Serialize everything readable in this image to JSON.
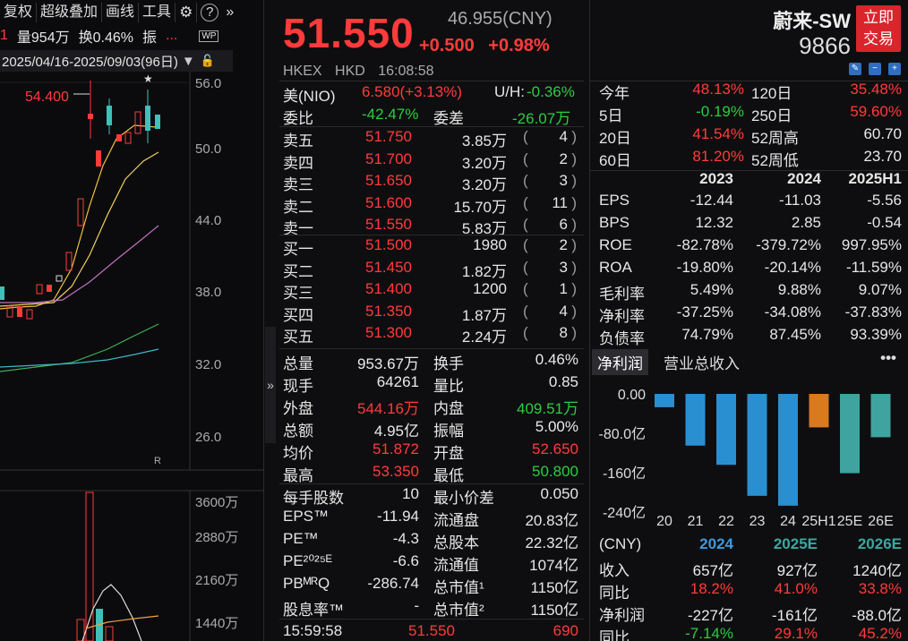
{
  "toolbar": {
    "items": [
      "复权",
      "超级叠加",
      "画线",
      "工具"
    ],
    "gear_icon": "gear-icon",
    "help_icon": "help-icon",
    "expand_icon": "double-chevron-right-icon"
  },
  "toolbar2": {
    "prefix": "1",
    "volume": "量954万",
    "turnover": "换0.46%",
    "amp": "振",
    "more": "...",
    "wp_badge": "WP"
  },
  "date_range": "2025/04/16-2025/09/03(96日)",
  "kline": {
    "price_ticks": [
      "56.0",
      "50.0",
      "44.0",
      "38.0",
      "32.0",
      "26.0"
    ],
    "high_marker": "54.400",
    "star": "★",
    "r_mark": "R",
    "volume_ticks": [
      "3600万",
      "2880万",
      "2160万",
      "1440万"
    ]
  },
  "quote": {
    "price": "51.550",
    "cny_price": "46.955(CNY)",
    "change": "+0.500",
    "change_pct": "+0.98%",
    "exchange": "HKEX",
    "currency": "HKD",
    "time": "16:08:58"
  },
  "adr": {
    "label": "美(NIO)",
    "value": "6.580(+3.13%)",
    "uh_label": "U/H:",
    "uh_value": "-0.36%"
  },
  "committee": {
    "ratio_label": "委比",
    "ratio": "-42.47%",
    "diff_label": "委差",
    "diff": "-26.07万"
  },
  "asks": [
    {
      "label": "卖五",
      "price": "51.750",
      "vol": "3.85万",
      "count": "4"
    },
    {
      "label": "卖四",
      "price": "51.700",
      "vol": "3.20万",
      "count": "2"
    },
    {
      "label": "卖三",
      "price": "51.650",
      "vol": "3.20万",
      "count": "3"
    },
    {
      "label": "卖二",
      "price": "51.600",
      "vol": "15.70万",
      "count": "11"
    },
    {
      "label": "卖一",
      "price": "51.550",
      "vol": "5.83万",
      "count": "6"
    }
  ],
  "bids": [
    {
      "label": "买一",
      "price": "51.500",
      "vol": "1980",
      "count": "2"
    },
    {
      "label": "买二",
      "price": "51.450",
      "vol": "1.82万",
      "count": "3"
    },
    {
      "label": "买三",
      "price": "51.400",
      "vol": "1200",
      "count": "1"
    },
    {
      "label": "买四",
      "price": "51.350",
      "vol": "1.87万",
      "count": "4"
    },
    {
      "label": "买五",
      "price": "51.300",
      "vol": "2.24万",
      "count": "8"
    }
  ],
  "stats": [
    {
      "l1": "总量",
      "v1": "953.67万",
      "c1": "white",
      "l2": "换手",
      "v2": "0.46%",
      "c2": "white"
    },
    {
      "l1": "现手",
      "v1": "64261",
      "c1": "white",
      "l2": "量比",
      "v2": "0.85",
      "c2": "white"
    },
    {
      "l1": "外盘",
      "v1": "544.16万",
      "c1": "red",
      "l2": "内盘",
      "v2": "409.51万",
      "c2": "green"
    },
    {
      "l1": "总额",
      "v1": "4.95亿",
      "c1": "white",
      "l2": "振幅",
      "v2": "5.00%",
      "c2": "white"
    },
    {
      "l1": "均价",
      "v1": "51.872",
      "c1": "red",
      "l2": "开盘",
      "v2": "52.650",
      "c2": "red"
    },
    {
      "l1": "最高",
      "v1": "53.350",
      "c1": "red",
      "l2": "最低",
      "v2": "50.800",
      "c2": "green"
    }
  ],
  "fund": [
    {
      "l1": "每手股数",
      "v1": "10",
      "l2": "最小价差",
      "v2": "0.050"
    },
    {
      "l1": "EPS™",
      "v1": "-11.94",
      "l2": "流通盘",
      "v2": "20.83亿"
    },
    {
      "l1": "PE™",
      "v1": "-4.3",
      "l2": "总股本",
      "v2": "22.32亿"
    },
    {
      "l1": "PE²⁰²⁵ᴱ",
      "v1": "-6.6",
      "l2": "流通值",
      "v2": "1074亿"
    },
    {
      "l1": "PBᴹᴿQ",
      "v1": "-286.74",
      "l2": "总市值¹",
      "v2": "1150亿"
    },
    {
      "l1": "股息率™",
      "v1": "-",
      "l2": "总市值²",
      "v2": "1150亿"
    }
  ],
  "last_trade": {
    "time": "15:59:58",
    "price": "51.550",
    "vol": "690"
  },
  "stock": {
    "name": "蔚来-SW",
    "code": "9866",
    "trade_btn_l1": "立即",
    "trade_btn_l2": "交易"
  },
  "perf": [
    {
      "l1": "今年",
      "v1": "48.13%",
      "c1": "red",
      "l2": "120日",
      "v2": "35.48%",
      "c2": "red"
    },
    {
      "l1": "5日",
      "v1": "-0.19%",
      "c1": "green",
      "l2": "250日",
      "v2": "59.60%",
      "c2": "red"
    },
    {
      "l1": "20日",
      "v1": "41.54%",
      "c1": "red",
      "l2": "52周高",
      "v2": "60.70",
      "c2": "white"
    },
    {
      "l1": "60日",
      "v1": "81.20%",
      "c1": "red",
      "l2": "52周低",
      "v2": "23.70",
      "c2": "white"
    }
  ],
  "fin_header": [
    "2023",
    "2024",
    "2025H1"
  ],
  "fin_rows": [
    {
      "label": "EPS",
      "vals": [
        "-12.44",
        "-11.03",
        "-5.56"
      ]
    },
    {
      "label": "BPS",
      "vals": [
        "12.32",
        "2.85",
        "-0.54"
      ]
    },
    {
      "label": "ROE",
      "vals": [
        "-82.78%",
        "-379.72%",
        "997.95%"
      ]
    },
    {
      "label": "ROA",
      "vals": [
        "-19.80%",
        "-20.14%",
        "-11.59%"
      ]
    },
    {
      "label": "毛利率",
      "vals": [
        "5.49%",
        "9.88%",
        "9.07%"
      ]
    },
    {
      "label": "净利率",
      "vals": [
        "-37.25%",
        "-34.08%",
        "-37.83%"
      ]
    },
    {
      "label": "负债率",
      "vals": [
        "74.79%",
        "87.45%",
        "93.39%"
      ]
    }
  ],
  "tabs": {
    "profit": "净利润",
    "revenue": "营业总收入",
    "more": "•••"
  },
  "chart_data": {
    "type": "bar",
    "categories": [
      "20",
      "21",
      "22",
      "23",
      "24",
      "25H1",
      "25E",
      "26E"
    ],
    "values": [
      -27,
      -105,
      -144,
      -207,
      -227,
      -68,
      -161,
      -88
    ],
    "yticks": [
      "0.00",
      "-80.0亿",
      "-160亿",
      "-240亿"
    ],
    "ylim": [
      -240,
      0
    ],
    "colors": [
      "#2a8fd0",
      "#2a8fd0",
      "#2a8fd0",
      "#2a8fd0",
      "#2a8fd0",
      "#d97a1e",
      "#3fa3a0",
      "#3fa3a0"
    ]
  },
  "forecast": {
    "header": [
      "(CNY)",
      "2024",
      "2025E",
      "2026E"
    ],
    "rows": [
      {
        "label": "收入",
        "vals": [
          "657亿",
          "927亿",
          "1240亿"
        ],
        "colors": [
          "white",
          "white",
          "white"
        ]
      },
      {
        "label": "同比",
        "vals": [
          "18.2%",
          "41.0%",
          "33.8%"
        ],
        "colors": [
          "red",
          "red",
          "red"
        ]
      },
      {
        "label": "净利润",
        "vals": [
          "-227亿",
          "-161亿",
          "-88.0亿"
        ],
        "colors": [
          "white",
          "white",
          "white"
        ]
      },
      {
        "label": "同比",
        "vals": [
          "-7.14%",
          "29.1%",
          "45.2%"
        ],
        "colors": [
          "green",
          "red",
          "red"
        ]
      }
    ]
  }
}
